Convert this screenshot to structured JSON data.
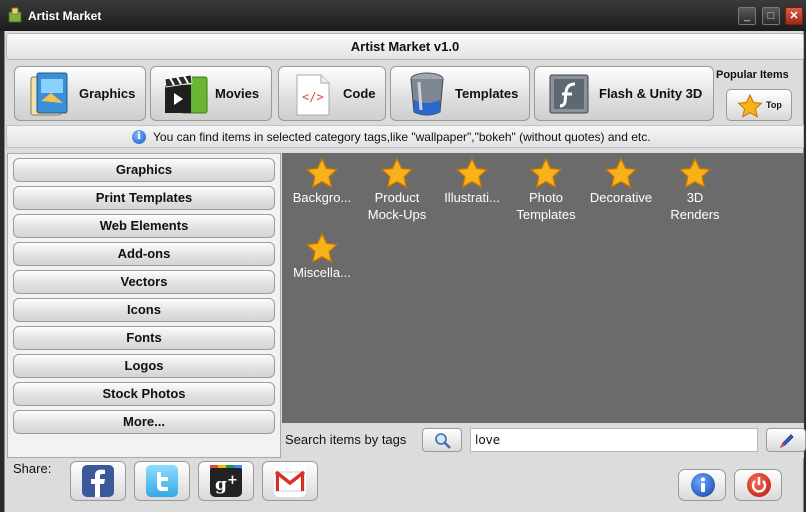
{
  "window": {
    "title": "Artist Market"
  },
  "app_title": "Artist Market v1.0",
  "categories": [
    {
      "label": "Graphics",
      "icon": "graphics-book-icon"
    },
    {
      "label": "Movies",
      "icon": "film-clapper-icon"
    },
    {
      "label": "Code",
      "icon": "code-document-icon"
    },
    {
      "label": "Templates",
      "icon": "paint-bucket-icon"
    },
    {
      "label": "Flash & Unity 3D",
      "icon": "flash-icon"
    }
  ],
  "popular": {
    "label": "Popular Items",
    "top_label": "Top"
  },
  "info": {
    "text": "You can find items in selected category tags,like \"wallpaper\",\"bokeh\" (without quotes) and etc."
  },
  "sidebar": {
    "items": [
      "Graphics",
      "Print Templates",
      "Web Elements",
      "Add-ons",
      "Vectors",
      "Icons",
      "Fonts",
      "Logos",
      "Stock Photos",
      "More..."
    ]
  },
  "gallery": {
    "items": [
      {
        "line1": "Backgro...",
        "line2": ""
      },
      {
        "line1": "Product",
        "line2": "Mock-Ups"
      },
      {
        "line1": "Illustrati...",
        "line2": ""
      },
      {
        "line1": "Photo",
        "line2": "Templates"
      },
      {
        "line1": "Decorative",
        "line2": ""
      },
      {
        "line1": "3D",
        "line2": "Renders"
      },
      {
        "line1": "Miscella...",
        "line2": ""
      }
    ]
  },
  "search": {
    "label": "Search items by tags",
    "value": "love"
  },
  "share": {
    "label": "Share:"
  },
  "colors": {
    "gallery_bg": "#6b6b6b",
    "star": "#f7b21a",
    "facebook": "#3b5998",
    "twitter": "#4fc3f7",
    "google_plus": "#dd4b39"
  }
}
